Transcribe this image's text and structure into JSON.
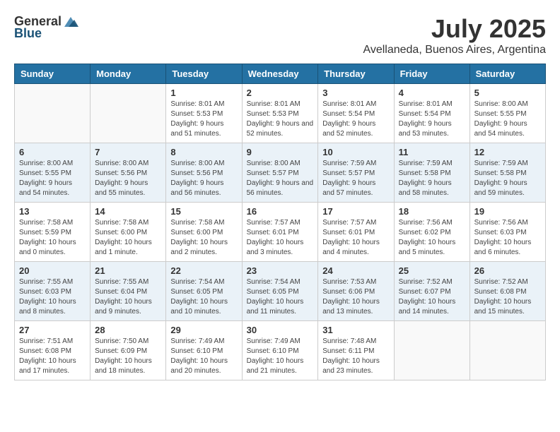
{
  "logo": {
    "general": "General",
    "blue": "Blue"
  },
  "title": "July 2025",
  "location": "Avellaneda, Buenos Aires, Argentina",
  "weekdays": [
    "Sunday",
    "Monday",
    "Tuesday",
    "Wednesday",
    "Thursday",
    "Friday",
    "Saturday"
  ],
  "weeks": [
    [
      null,
      null,
      {
        "day": 1,
        "sunrise": "8:01 AM",
        "sunset": "5:53 PM",
        "daylight": "9 hours and 51 minutes."
      },
      {
        "day": 2,
        "sunrise": "8:01 AM",
        "sunset": "5:53 PM",
        "daylight": "9 hours and 52 minutes."
      },
      {
        "day": 3,
        "sunrise": "8:01 AM",
        "sunset": "5:54 PM",
        "daylight": "9 hours and 52 minutes."
      },
      {
        "day": 4,
        "sunrise": "8:01 AM",
        "sunset": "5:54 PM",
        "daylight": "9 hours and 53 minutes."
      },
      {
        "day": 5,
        "sunrise": "8:00 AM",
        "sunset": "5:55 PM",
        "daylight": "9 hours and 54 minutes."
      }
    ],
    [
      {
        "day": 6,
        "sunrise": "8:00 AM",
        "sunset": "5:55 PM",
        "daylight": "9 hours and 54 minutes."
      },
      {
        "day": 7,
        "sunrise": "8:00 AM",
        "sunset": "5:56 PM",
        "daylight": "9 hours and 55 minutes."
      },
      {
        "day": 8,
        "sunrise": "8:00 AM",
        "sunset": "5:56 PM",
        "daylight": "9 hours and 56 minutes."
      },
      {
        "day": 9,
        "sunrise": "8:00 AM",
        "sunset": "5:57 PM",
        "daylight": "9 hours and 56 minutes."
      },
      {
        "day": 10,
        "sunrise": "7:59 AM",
        "sunset": "5:57 PM",
        "daylight": "9 hours and 57 minutes."
      },
      {
        "day": 11,
        "sunrise": "7:59 AM",
        "sunset": "5:58 PM",
        "daylight": "9 hours and 58 minutes."
      },
      {
        "day": 12,
        "sunrise": "7:59 AM",
        "sunset": "5:58 PM",
        "daylight": "9 hours and 59 minutes."
      }
    ],
    [
      {
        "day": 13,
        "sunrise": "7:58 AM",
        "sunset": "5:59 PM",
        "daylight": "10 hours and 0 minutes."
      },
      {
        "day": 14,
        "sunrise": "7:58 AM",
        "sunset": "6:00 PM",
        "daylight": "10 hours and 1 minute."
      },
      {
        "day": 15,
        "sunrise": "7:58 AM",
        "sunset": "6:00 PM",
        "daylight": "10 hours and 2 minutes."
      },
      {
        "day": 16,
        "sunrise": "7:57 AM",
        "sunset": "6:01 PM",
        "daylight": "10 hours and 3 minutes."
      },
      {
        "day": 17,
        "sunrise": "7:57 AM",
        "sunset": "6:01 PM",
        "daylight": "10 hours and 4 minutes."
      },
      {
        "day": 18,
        "sunrise": "7:56 AM",
        "sunset": "6:02 PM",
        "daylight": "10 hours and 5 minutes."
      },
      {
        "day": 19,
        "sunrise": "7:56 AM",
        "sunset": "6:03 PM",
        "daylight": "10 hours and 6 minutes."
      }
    ],
    [
      {
        "day": 20,
        "sunrise": "7:55 AM",
        "sunset": "6:03 PM",
        "daylight": "10 hours and 8 minutes."
      },
      {
        "day": 21,
        "sunrise": "7:55 AM",
        "sunset": "6:04 PM",
        "daylight": "10 hours and 9 minutes."
      },
      {
        "day": 22,
        "sunrise": "7:54 AM",
        "sunset": "6:05 PM",
        "daylight": "10 hours and 10 minutes."
      },
      {
        "day": 23,
        "sunrise": "7:54 AM",
        "sunset": "6:05 PM",
        "daylight": "10 hours and 11 minutes."
      },
      {
        "day": 24,
        "sunrise": "7:53 AM",
        "sunset": "6:06 PM",
        "daylight": "10 hours and 13 minutes."
      },
      {
        "day": 25,
        "sunrise": "7:52 AM",
        "sunset": "6:07 PM",
        "daylight": "10 hours and 14 minutes."
      },
      {
        "day": 26,
        "sunrise": "7:52 AM",
        "sunset": "6:08 PM",
        "daylight": "10 hours and 15 minutes."
      }
    ],
    [
      {
        "day": 27,
        "sunrise": "7:51 AM",
        "sunset": "6:08 PM",
        "daylight": "10 hours and 17 minutes."
      },
      {
        "day": 28,
        "sunrise": "7:50 AM",
        "sunset": "6:09 PM",
        "daylight": "10 hours and 18 minutes."
      },
      {
        "day": 29,
        "sunrise": "7:49 AM",
        "sunset": "6:10 PM",
        "daylight": "10 hours and 20 minutes."
      },
      {
        "day": 30,
        "sunrise": "7:49 AM",
        "sunset": "6:10 PM",
        "daylight": "10 hours and 21 minutes."
      },
      {
        "day": 31,
        "sunrise": "7:48 AM",
        "sunset": "6:11 PM",
        "daylight": "10 hours and 23 minutes."
      },
      null,
      null
    ]
  ]
}
